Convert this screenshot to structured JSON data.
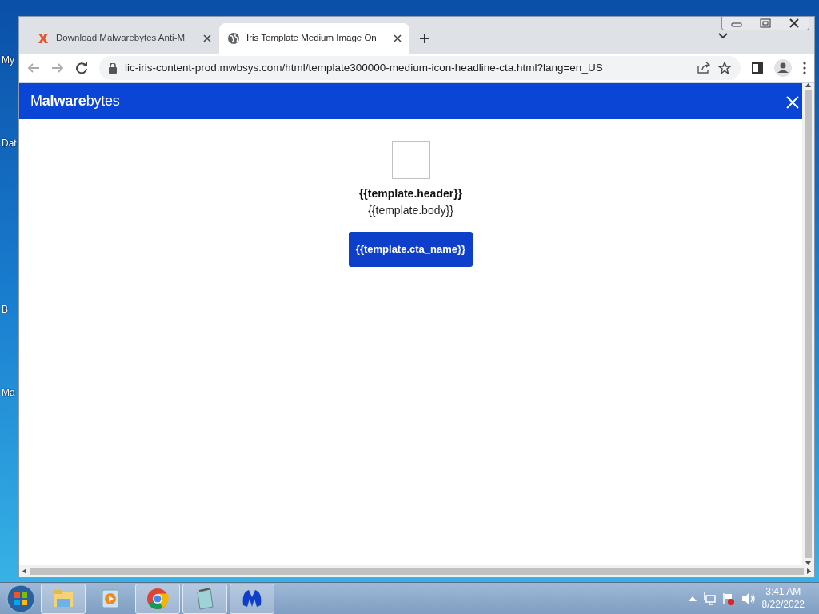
{
  "desktop_icons": [
    {
      "label": "My"
    },
    {
      "label": "Dat"
    },
    {
      "label": "B"
    },
    {
      "label": "Ma"
    }
  ],
  "browser": {
    "tabs": [
      {
        "title": "Download Malwarebytes Anti-M",
        "selected": false,
        "kind": "malwarebytes"
      },
      {
        "title": "Iris Template Medium Image On",
        "selected": true,
        "kind": "globe"
      }
    ],
    "url": "lic-iris-content-prod.mwbsys.com/html/template300000-medium-icon-headline-cta.html?lang=en_US"
  },
  "page": {
    "logo": "M**alware**bytes",
    "header": "{{template.header}}",
    "body": "{{template.body}}",
    "cta": "{{template.cta_name}}"
  },
  "taskbar": {
    "apps": [
      {
        "kind": "folder",
        "running": true
      },
      {
        "kind": "media",
        "running": false
      },
      {
        "kind": "chrome",
        "running": true
      },
      {
        "kind": "notepad",
        "running": true
      },
      {
        "kind": "malwarebytes",
        "running": true
      }
    ],
    "time": "3:41 AM",
    "date": "8/22/2022"
  }
}
